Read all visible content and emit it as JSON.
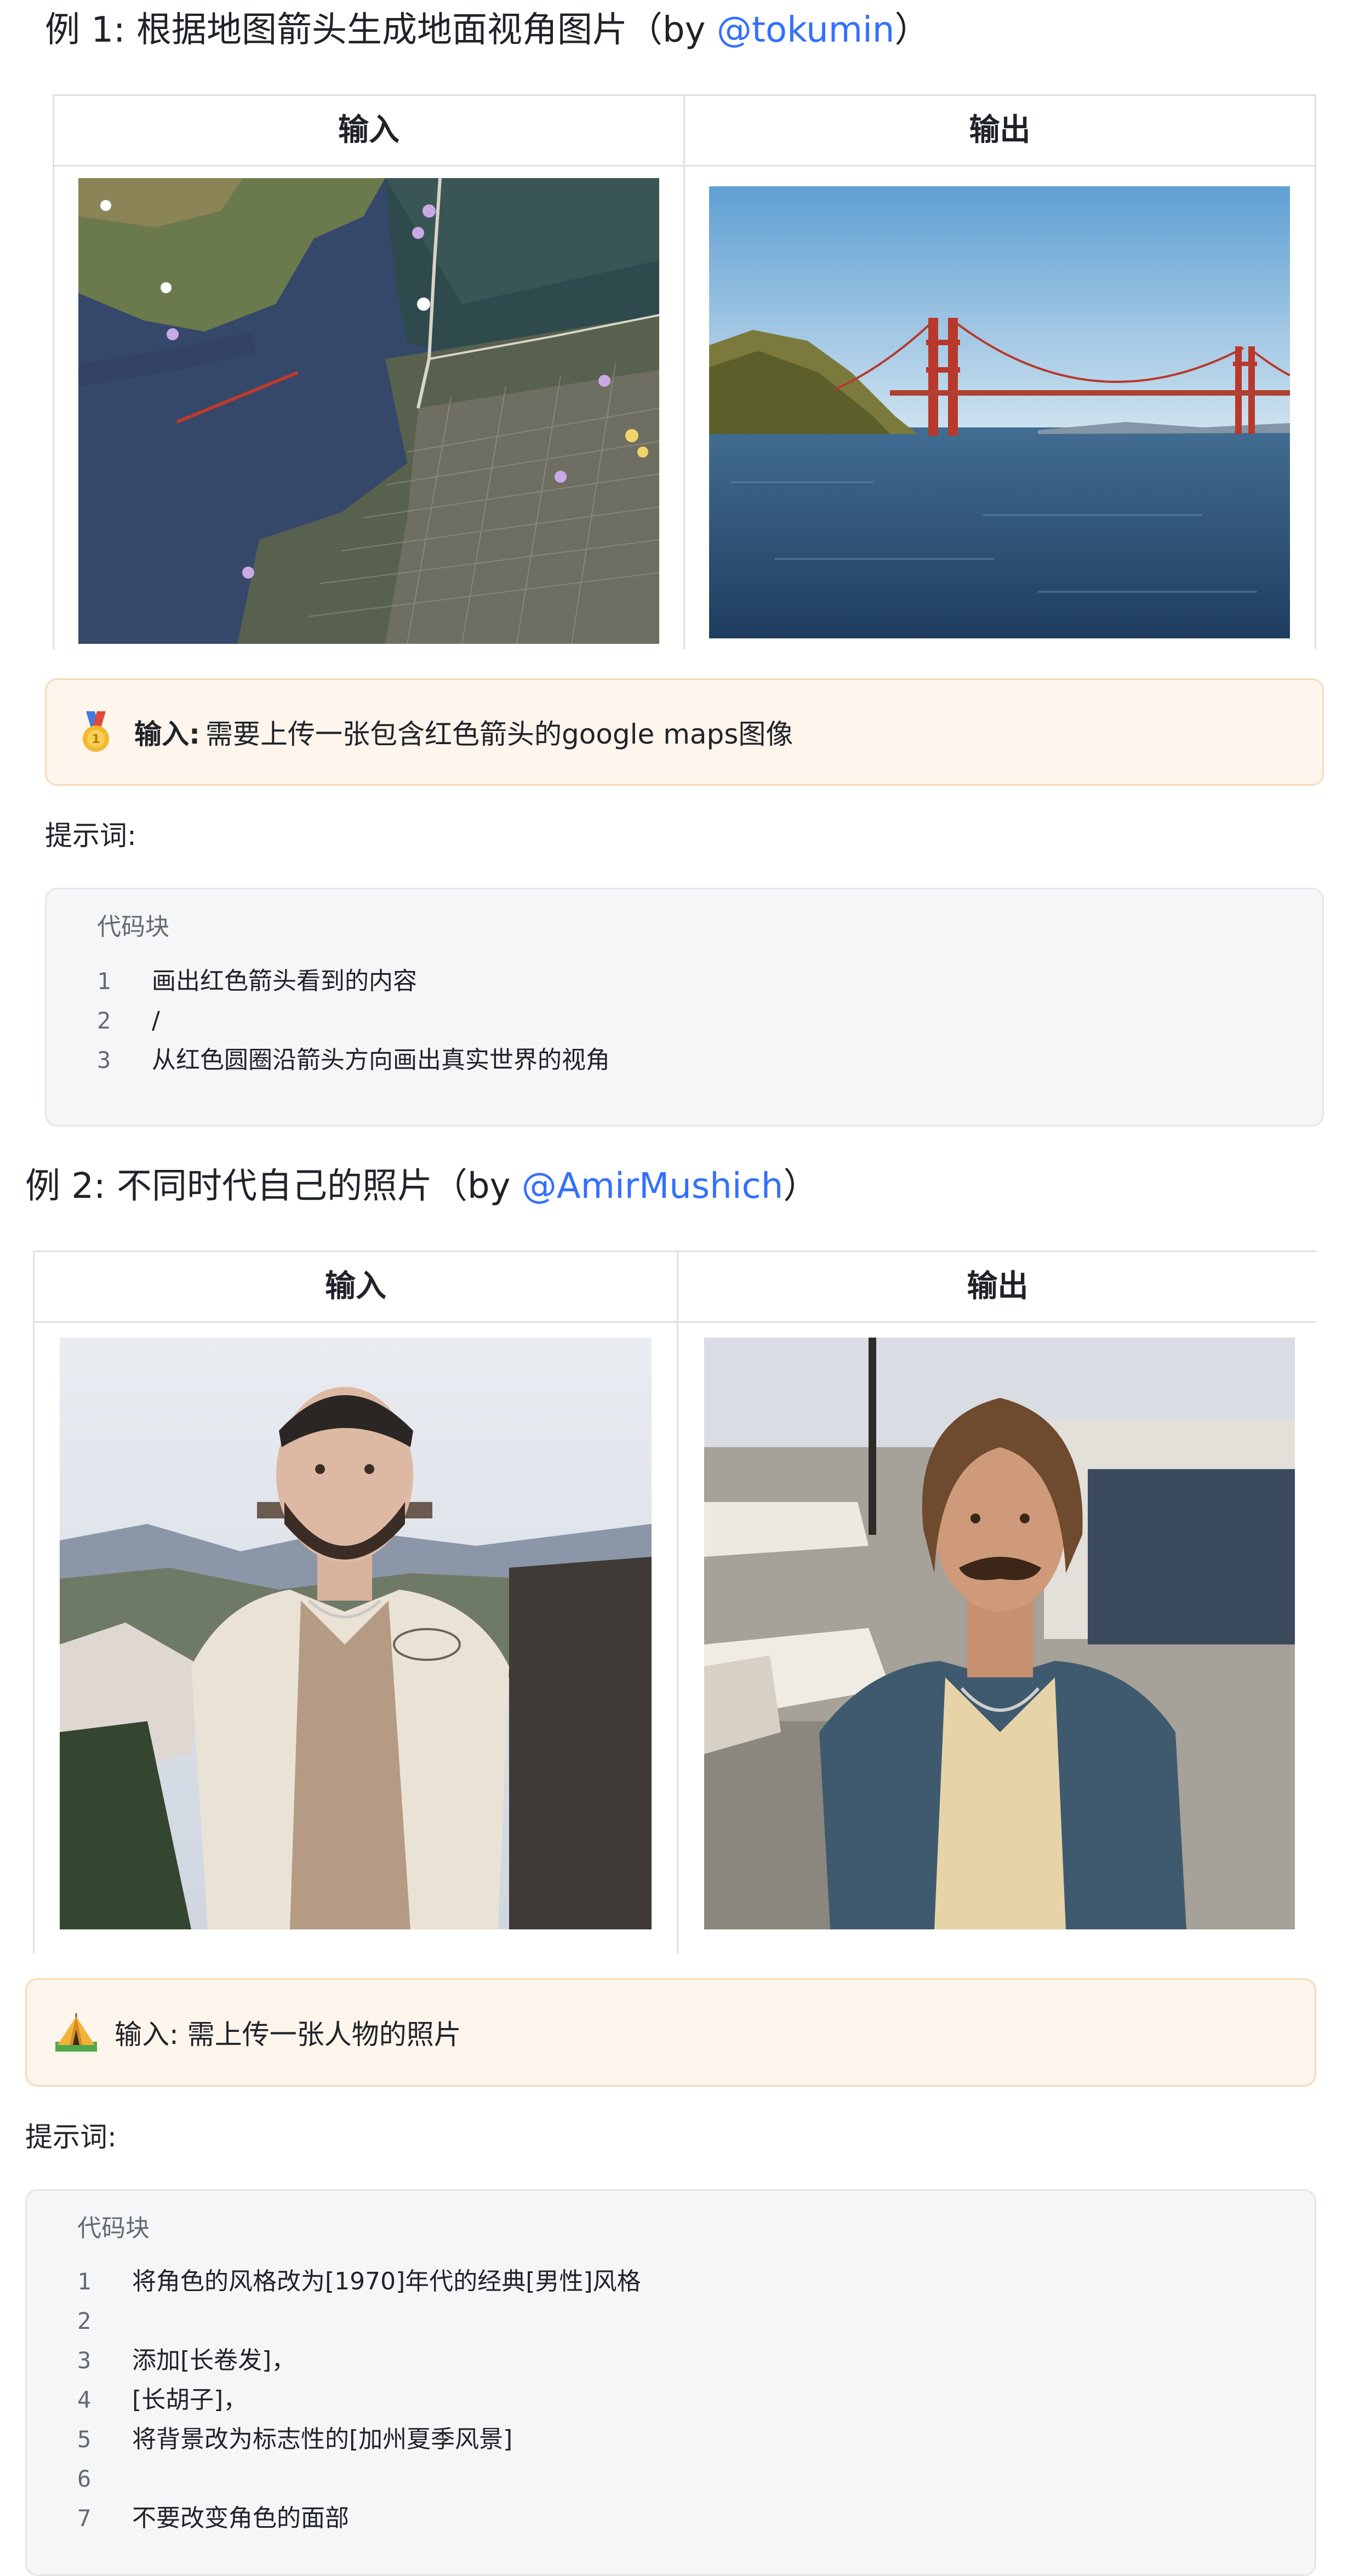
{
  "example1": {
    "heading_prefix": "例 1: 根据地图箭头生成地面视角图片（by ",
    "handle": "@tokumin",
    "heading_suffix": "）",
    "table": {
      "col_input": "输入",
      "col_output": "输出"
    },
    "callout": {
      "emoji": "medal-icon",
      "label": "输入:",
      "text": "需要上传一张包含红色箭头的google maps图像"
    },
    "prompt_label": "提示词:",
    "code": {
      "title": "代码块",
      "lines": [
        {
          "n": "1",
          "t": "画出红色箭头看到的内容"
        },
        {
          "n": "2",
          "t": "/"
        },
        {
          "n": "3",
          "t": "从红色圆圈沿箭头方向画出真实世界的视角"
        }
      ]
    }
  },
  "example2": {
    "heading_prefix": "例 2: 不同时代自己的照片（by ",
    "handle": "@AmirMushich",
    "heading_suffix": "）",
    "table": {
      "col_input": "输入",
      "col_output": "输出"
    },
    "callout": {
      "emoji": "tent-icon",
      "text": "输入: 需上传一张人物的照片"
    },
    "prompt_label": "提示词:",
    "code": {
      "title": "代码块",
      "lines": [
        {
          "n": "1",
          "t": "将角色的风格改为[1970]年代的经典[男性]风格"
        },
        {
          "n": "2",
          "t": ""
        },
        {
          "n": "3",
          "t": "添加[长卷发]，"
        },
        {
          "n": "4",
          "t": "[长胡子]，"
        },
        {
          "n": "5",
          "t": "将背景改为标志性的[加州夏季风景]"
        },
        {
          "n": "6",
          "t": ""
        },
        {
          "n": "7",
          "t": "不要改变角色的面部"
        }
      ]
    }
  }
}
